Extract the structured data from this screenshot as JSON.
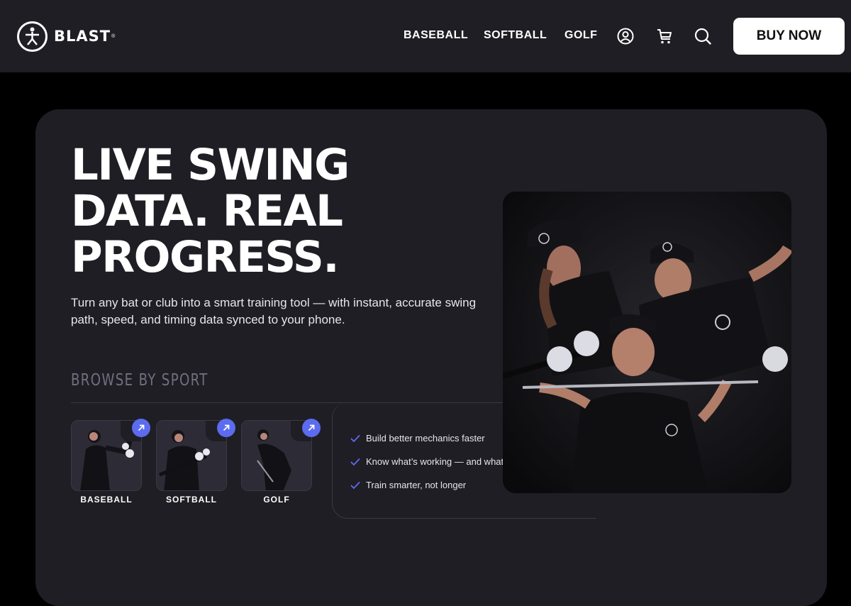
{
  "header": {
    "logo_text": "BLAST",
    "logo_reg": "®",
    "nav": [
      "BASEBALL",
      "SOFTBALL",
      "GOLF"
    ],
    "icons": [
      "account-icon",
      "cart-icon",
      "search-icon"
    ],
    "buy_now": "BUY NOW"
  },
  "hero": {
    "headline": [
      "LIVE SWING",
      "DATA. REAL",
      "PROGRESS."
    ],
    "subtext": "Turn any bat or club into a smart training tool — with instant, accurate swing path, speed, and timing data synced to your phone.",
    "browse_title": "BROWSE BY SPORT",
    "sports": [
      {
        "label": "BASEBALL",
        "icon": "arrow-up-right-icon"
      },
      {
        "label": "SOFTBALL",
        "icon": "arrow-up-right-icon"
      },
      {
        "label": "GOLF",
        "icon": "arrow-up-right-icon"
      }
    ],
    "benefits": [
      "Build better mechanics faster",
      "Know what’s working — and what’s not",
      "Train smarter, not longer"
    ],
    "photo": "athletes-photo"
  },
  "colors": {
    "header_bg": "#1f1e24",
    "page_bg": "#000000",
    "card_bg": "#1f1e24",
    "accent": "#5b6cf0",
    "muted_title": "#6f6f80",
    "button_bg": "#ffffff"
  }
}
